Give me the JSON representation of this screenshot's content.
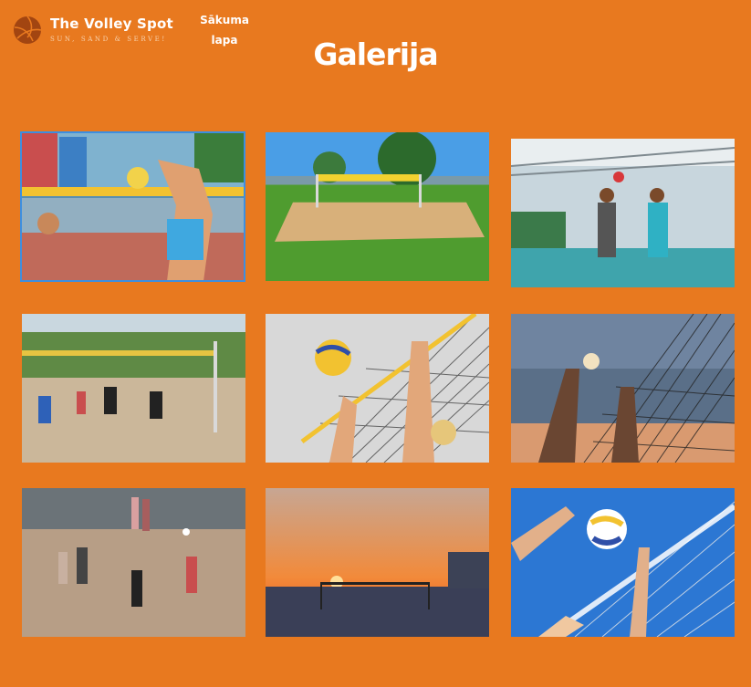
{
  "brand": {
    "title": "The Volley Spot",
    "tagline": "SUN, SAND & SERVE!",
    "logo_icon": "volleyball-icon"
  },
  "nav": {
    "home_label": "Sākuma lapa"
  },
  "page": {
    "title": "Galerija"
  },
  "gallery": {
    "images": [
      {
        "subject": "player-spiking-at-tournament",
        "selected": true
      },
      {
        "subject": "empty-beach-volleyball-court"
      },
      {
        "subject": "women-blocking-at-indoor-sand-court"
      },
      {
        "subject": "group-playing-on-sand-court"
      },
      {
        "subject": "players-blocking-ball-at-net"
      },
      {
        "subject": "silhouette-players-at-net"
      },
      {
        "subject": "people-playing-on-beach"
      },
      {
        "subject": "sunset-beach-volleyball-net"
      },
      {
        "subject": "hands-reaching-for-ball-blue-sky"
      }
    ]
  },
  "colors": {
    "background": "#e8791f",
    "accent_selected": "#3d8fe0",
    "text": "#ffffff"
  }
}
